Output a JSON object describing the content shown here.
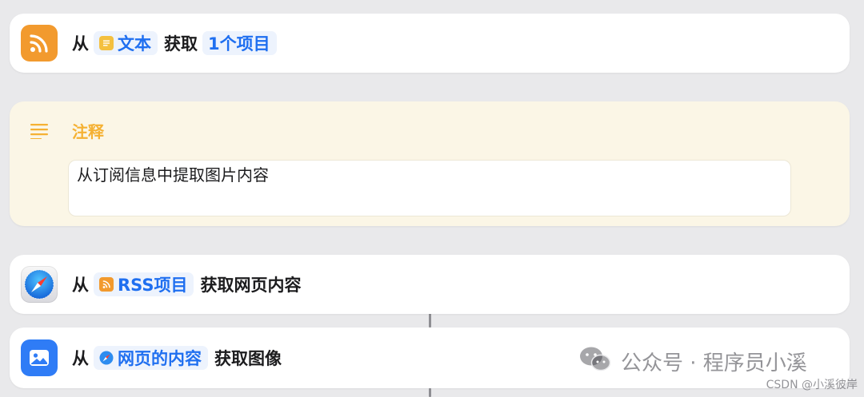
{
  "actions": [
    {
      "prefix": "从",
      "token": "文本",
      "middle": "获取",
      "result_token": "1个项目"
    },
    {
      "prefix": "从",
      "token": "RSS项目",
      "suffix": "获取网页内容"
    },
    {
      "prefix": "从",
      "token": "网页的内容",
      "suffix": "获取图像"
    }
  ],
  "comment": {
    "title": "注释",
    "text": "从订阅信息中提取图片内容"
  },
  "watermark": {
    "text": "公众号 · 程序员小溪"
  },
  "credit": "CSDN @小溪彼岸",
  "colors": {
    "rss_orange": "#f29a2e",
    "token_blue": "#1f6ff0",
    "comment_yellow": "#f5b133",
    "photo_blue": "#2f7cf6",
    "text_token_yellow": "#f4c03f"
  },
  "icons": [
    "rss-icon",
    "text-document-icon",
    "lines-icon",
    "safari-icon",
    "photo-icon"
  ]
}
